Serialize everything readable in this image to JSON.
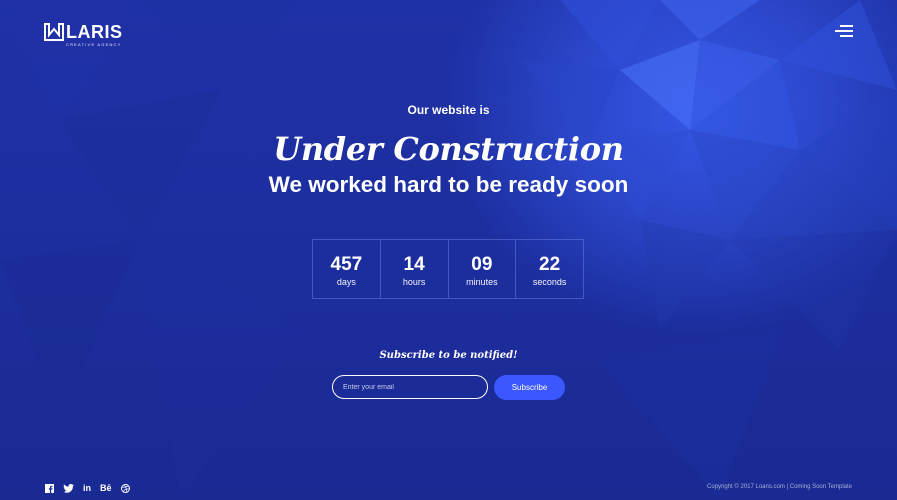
{
  "brand": {
    "name": "LARIS",
    "tagline": "CREATIVE AGENCY"
  },
  "header": {
    "menu_icon": "hamburger-menu-icon"
  },
  "hero": {
    "kicker": "Our website is",
    "headline": "Under Construction",
    "subhead": "We worked hard to be ready soon"
  },
  "countdown": [
    {
      "value": "457",
      "label": "days"
    },
    {
      "value": "14",
      "label": "hours"
    },
    {
      "value": "09",
      "label": "minutes"
    },
    {
      "value": "22",
      "label": "seconds"
    }
  ],
  "subscribe": {
    "title": "Subscribe to be notified!",
    "placeholder": "Enter your email",
    "button_label": "Subscribe"
  },
  "footer": {
    "social": [
      {
        "name": "facebook-icon",
        "glyph": "f"
      },
      {
        "name": "twitter-icon",
        "glyph": ""
      },
      {
        "name": "linkedin-icon",
        "glyph": "in"
      },
      {
        "name": "behance-icon",
        "glyph": "Bē"
      },
      {
        "name": "dribbble-icon",
        "glyph": ""
      }
    ],
    "copyright": "Copyright © 2017 Loans.com | Coming Soon Template"
  },
  "colors": {
    "background": "#1d2ea0",
    "accent": "#3b57ff",
    "text": "#ffffff"
  }
}
